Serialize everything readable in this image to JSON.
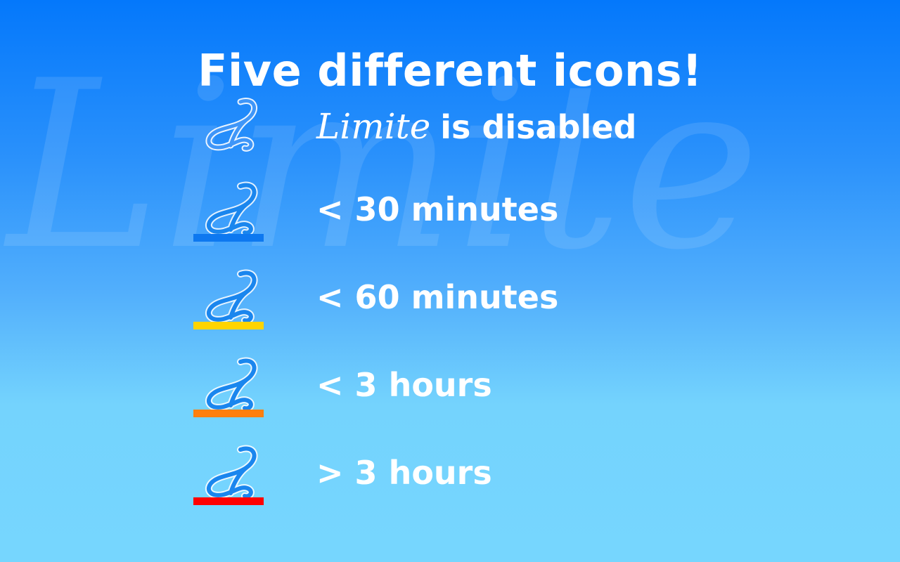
{
  "title": "Five different icons!",
  "watermark": {
    "text": "Limite"
  },
  "colors": {
    "background_top": "#0478fb",
    "background_bottom": "#76d6fe",
    "text": "#ffffff",
    "icon_fill": "#1a86ee",
    "icon_outline": "#ffffff"
  },
  "rows": [
    {
      "brand": "Limite",
      "label": "is disabled",
      "icon": "limite-script-l-icon-outline",
      "bar_color": null
    },
    {
      "label": "< 30 minutes",
      "icon": "limite-script-l-icon",
      "bar_color": "#0d78f0"
    },
    {
      "label": "< 60 minutes",
      "icon": "limite-script-l-icon",
      "bar_color": "#ffd400"
    },
    {
      "label": "< 3 hours",
      "icon": "limite-script-l-icon",
      "bar_color": "#ff7f0e"
    },
    {
      "label": "> 3 hours",
      "icon": "limite-script-l-icon",
      "bar_color": "#ff0000"
    }
  ]
}
